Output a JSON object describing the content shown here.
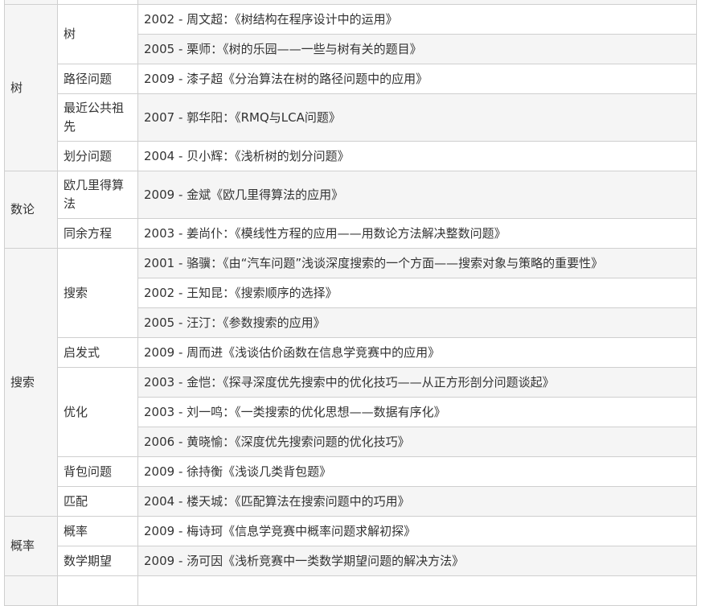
{
  "rows": [
    {
      "paper": ""
    },
    {
      "category": "树",
      "subcategory": "树",
      "paper": "2002 - 周文超：《树结构在程序设计中的运用》"
    },
    {
      "paper": "2005 - 栗师：《树的乐园——一些与树有关的题目》"
    },
    {
      "subcategory": "路径问题",
      "paper": "2009 - 漆子超《分治算法在树的路径问题中的应用》"
    },
    {
      "subcategory": "最近公共祖先",
      "paper": "2007 - 郭华阳：《RMQ与LCA问题》"
    },
    {
      "subcategory": "划分问题",
      "paper": "2004 - 贝小辉：《浅析树的划分问题》"
    },
    {
      "category": "数论",
      "subcategory": "欧几里得算法",
      "paper": "2009 - 金斌《欧几里得算法的应用》"
    },
    {
      "subcategory": "同余方程",
      "paper": "2003 - 姜尚仆：《模线性方程的应用——用数论方法解决整数问题》"
    },
    {
      "category": "搜索",
      "subcategory": "搜索",
      "paper": "2001 - 骆骥：《由“汽车问题”浅谈深度搜索的一个方面——搜索对象与策略的重要性》"
    },
    {
      "paper": "2002 - 王知昆：《搜索顺序的选择》"
    },
    {
      "paper": "2005 - 汪汀：《参数搜索的应用》"
    },
    {
      "subcategory": "启发式",
      "paper": "2009 - 周而进《浅谈估价函数在信息学竞赛中的应用》"
    },
    {
      "subcategory": "优化",
      "paper": "2003 - 金恺：《探寻深度优先搜索中的优化技巧——从正方形剖分问题谈起》"
    },
    {
      "paper": "2003 - 刘一鸣：《一类搜索的优化思想——数据有序化》"
    },
    {
      "paper": "2006 - 黄晓愉：《深度优先搜索问题的优化技巧》"
    },
    {
      "subcategory": "背包问题",
      "paper": "2009 - 徐持衡《浅谈几类背包题》"
    },
    {
      "subcategory": "匹配",
      "paper": "2004 - 楼天城：《匹配算法在搜索问题中的巧用》"
    },
    {
      "category": "概率",
      "subcategory": "概率",
      "paper": "2009 - 梅诗珂《信息学竞赛中概率问题求解初探》"
    },
    {
      "subcategory": "数学期望",
      "paper": "2009 - 汤可因《浅析竞赛中一类数学期望问题的解决方法》"
    },
    {
      "paper": ""
    }
  ]
}
